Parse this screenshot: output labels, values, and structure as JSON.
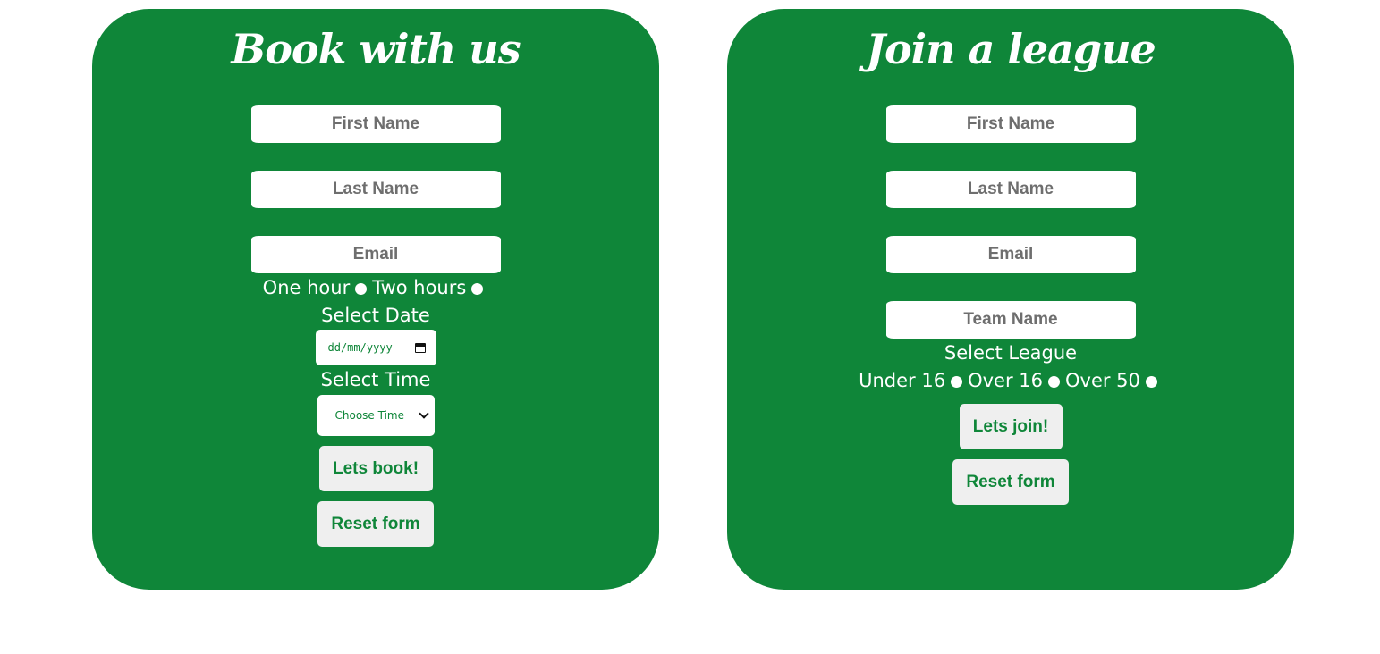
{
  "book_form": {
    "title": "Book with us",
    "first_name_placeholder": "First Name",
    "last_name_placeholder": "Last Name",
    "email_placeholder": "Email",
    "duration_options": [
      "One hour",
      "Two hours"
    ],
    "select_date_label": "Select Date",
    "date_placeholder": "dd/mm/yyyy",
    "select_time_label": "Select Time",
    "time_select_value": "Choose Time",
    "submit_label": "Lets book!",
    "reset_label": "Reset form"
  },
  "league_form": {
    "title": "Join a league",
    "first_name_placeholder": "First Name",
    "last_name_placeholder": "Last Name",
    "email_placeholder": "Email",
    "team_name_placeholder": "Team Name",
    "select_league_label": "Select League",
    "league_options": [
      "Under 16",
      "Over 16",
      "Over 50"
    ],
    "submit_label": "Lets join!",
    "reset_label": "Reset form"
  },
  "colors": {
    "card_background": "#0f8639",
    "page_background": "#ffffff",
    "input_background": "#ffffff",
    "input_text": "#6e6e6e",
    "button_background": "#efefef",
    "button_text": "#0f8639"
  }
}
